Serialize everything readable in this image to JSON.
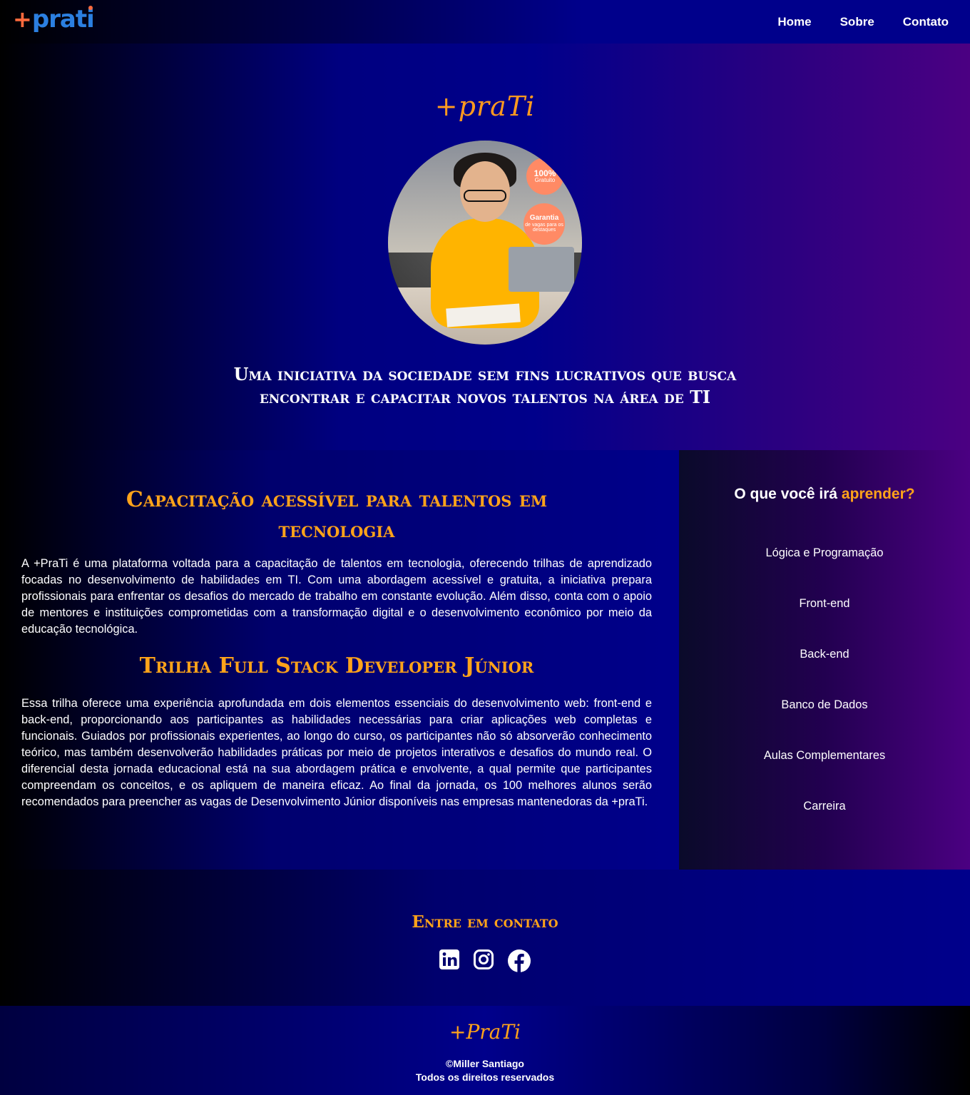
{
  "header": {
    "logo": {
      "plus": "+",
      "text_pr": "pra",
      "text_ti": "ti"
    },
    "nav": [
      {
        "label": "Home"
      },
      {
        "label": "Sobre"
      },
      {
        "label": "Contato"
      }
    ]
  },
  "hero": {
    "brand": "+praTi",
    "badges": {
      "free_big": "100%",
      "free_small": "Gratuito",
      "guarantee_big": "Garantia",
      "guarantee_small": "de vagas para os destaques"
    },
    "tagline": "Uma iniciativa da sociedade sem fins lucrativos que busca encontrar e capacitar novos talentos na área de TI"
  },
  "main": {
    "title1": "Capacitação acessível para talentos em tecnologia",
    "paragraph1": "A +PraTi é uma plataforma voltada para a capacitação de talentos em tecnologia, oferecendo trilhas de aprendizado focadas no desenvolvimento de habilidades em TI. Com uma abordagem acessível e gratuita, a iniciativa prepara profissionais para enfrentar os desafios do mercado de trabalho em constante evolução. Além disso, conta com o apoio de mentores e instituições comprometidas com a transformação digital e o desenvolvimento econômico por meio da educação tecnológica.",
    "title2": "Trilha Full Stack Developer Júnior",
    "paragraph2": "Essa trilha oferece uma experiência aprofundada em dois elementos essenciais do desenvolvimento web: front-end e back-end, proporcionando aos participantes as habilidades necessárias para criar aplicações web completas e funcionais. Guiados por profissionais experientes, ao longo do curso, os participantes não só absorverão conhecimento teórico, mas também desenvolverão habilidades práticas por meio de projetos interativos e desafios do mundo real. O diferencial desta jornada educacional está na sua abordagem prática e envolvente, a qual permite que participantes compreendam os conceitos, e os apliquem de maneira eficaz. Ao final da jornada, os 100 melhores alunos serão recomendados para preencher as vagas de Desenvolvimento Júnior disponíveis nas empresas mantenedoras da +praTi."
  },
  "aside": {
    "heading_prefix": "O que você irá ",
    "heading_highlight": "aprender?",
    "items": [
      {
        "label": "Lógica e Programação"
      },
      {
        "label": "Front-end"
      },
      {
        "label": "Back-end"
      },
      {
        "label": "Banco de Dados"
      },
      {
        "label": "Aulas Complementares"
      },
      {
        "label": "Carreira"
      }
    ]
  },
  "contact": {
    "heading": "Entre em contato",
    "socials": [
      {
        "icon": "linkedin-icon"
      },
      {
        "icon": "instagram-icon"
      },
      {
        "icon": "facebook-icon"
      }
    ]
  },
  "footer": {
    "brand": "+PraTi",
    "copyright": "©Miller Santiago",
    "rights": "Todos os direitos reservados"
  },
  "colors": {
    "accent": "#ffa31a",
    "logo_blue": "#2b7fe0",
    "logo_orange": "#ff6a3d",
    "navy": "#00008b",
    "purple": "#4b0082"
  }
}
